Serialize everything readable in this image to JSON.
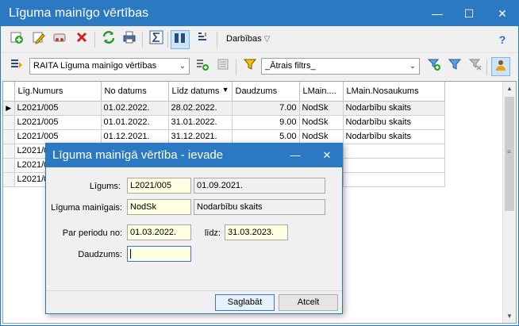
{
  "window": {
    "title": "Līguma mainīgo vērtības",
    "minimize": "—",
    "maximize": "☐",
    "close": "✕"
  },
  "toolbar": {
    "darbibas_label": "Darbības",
    "icons": [
      "add-icon",
      "edit-icon",
      "copy-icon",
      "delete-icon",
      "refresh-icon",
      "print-icon",
      "sum-icon",
      "columns-icon",
      "sort-icon",
      "help-icon"
    ]
  },
  "toolbar2": {
    "report_combo": "RAITA Līguma mainīgo vērtības",
    "filter_combo": "_Ātrais filtrs_"
  },
  "grid": {
    "columns": [
      "Līg.Numurs",
      "No datums",
      "Līdz datums",
      "Daudzums",
      "LMain....",
      "LMain.Nosaukums"
    ],
    "sort_indicator": "▼",
    "rows": [
      [
        "L2021/005",
        "01.02.2022.",
        "28.02.2022.",
        "7.00",
        "NodSk",
        "Nodarbību skaits"
      ],
      [
        "L2021/005",
        "01.01.2022.",
        "31.01.2022.",
        "9.00",
        "NodSk",
        "Nodarbību skaits"
      ],
      [
        "L2021/005",
        "01.12.2021.",
        "31.12.2021.",
        "5.00",
        "NodSk",
        "Nodarbību skaits"
      ],
      [
        "L2021/0",
        "",
        "",
        "",
        "",
        ""
      ],
      [
        "L2021/0",
        "",
        "",
        "",
        "",
        ""
      ],
      [
        "L2021/0",
        "",
        "",
        "",
        "",
        ""
      ]
    ]
  },
  "dialog": {
    "title": "Līguma mainīgā vērtība - ievade",
    "minimize": "—",
    "close": "✕",
    "ligums_label": "Līgums:",
    "ligums_value": "L2021/005",
    "ligums_date": "01.09.2021.",
    "mainigais_label": "Līguma mainīgais:",
    "mainigais_code": "NodSk",
    "mainigais_name": "Nodarbību skaits",
    "periods_label": "Par periodu no:",
    "period_from": "01.03.2022.",
    "lidz_label": "līdz:",
    "period_to": "31.03.2023.",
    "daudzums_label": "Daudzums:",
    "daudzums_value": "",
    "save_label": "Saglabāt",
    "cancel_label": "Atcelt"
  }
}
